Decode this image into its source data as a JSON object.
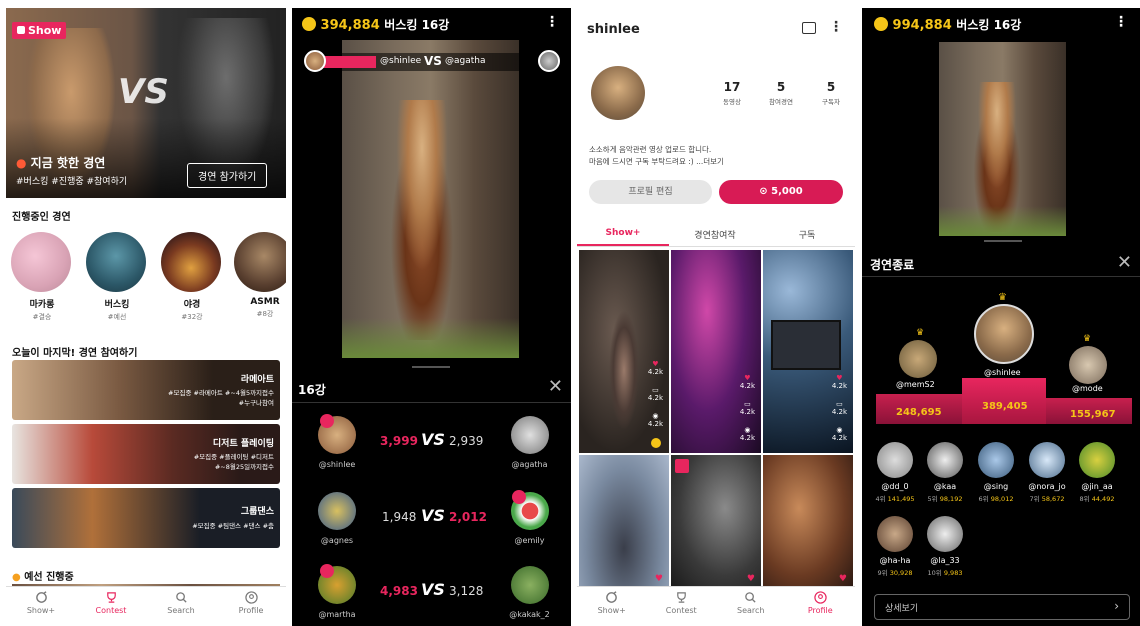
{
  "p1": {
    "hero_logo": "Show",
    "hero_title": "지금 핫한 경연",
    "hero_tags": "#버스킹 #진행중 #참여하기",
    "hero_button": "경연 참가하기",
    "hero_vs": "VS",
    "section1": "진행중인 경연",
    "cats": [
      {
        "name": "마카롱",
        "sub": "#결승"
      },
      {
        "name": "버스킹",
        "sub": "#예선"
      },
      {
        "name": "야경",
        "sub": "#32강"
      },
      {
        "name": "ASMR",
        "sub": "#8강"
      }
    ],
    "section2": "오늘이 마지막! 경연 참여하기",
    "banners": [
      {
        "title": "라메아트",
        "tags1": "#모집중 #라메아트 #~4월5까지접수",
        "tags2": "#누구나참여"
      },
      {
        "title": "디저트 플레이팅",
        "tags1": "#모집중 #플레이팅 #디저트",
        "tags2": "#~8월25일까지접수"
      },
      {
        "title": "그룹댄스",
        "tags1": "#모집중 #팀댄스 #댄스 #춤",
        "tags2": ""
      }
    ],
    "section3": "예선 진행중",
    "nav": [
      "Show+",
      "Contest",
      "Search",
      "Profile"
    ]
  },
  "p2": {
    "coins": "394,884",
    "header": "버스킹 16강",
    "vs_user1": "@shinlee",
    "vs_word": "VS",
    "vs_user2": "@agatha",
    "panel_title": "16강",
    "matches": [
      {
        "l": "@shinlee",
        "ls": "3,999",
        "r": "@agatha",
        "rs": "2,939",
        "win": "l"
      },
      {
        "l": "@agnes",
        "ls": "1,948",
        "r": "@emily",
        "rs": "2,012",
        "win": "r"
      },
      {
        "l": "@martha",
        "ls": "4,983",
        "r": "@kakak_2",
        "rs": "3,128",
        "win": "l"
      }
    ]
  },
  "p3": {
    "username": "shinlee",
    "stats": [
      {
        "n": "17",
        "l": "동영상"
      },
      {
        "n": "5",
        "l": "참여경연"
      },
      {
        "n": "5",
        "l": "구독자"
      }
    ],
    "bio1": "소소하게 음악관련 영상 업로드 합니다.",
    "bio2": "마음에 드시면 구독 부탁드려요 :) ...더보기",
    "edit_btn": "프로필 편집",
    "coin_btn": "5,000",
    "tabs": [
      "Show+",
      "경연참여작",
      "구독"
    ],
    "cnt": "4.2k",
    "nav": [
      "Show+",
      "Contest",
      "Search",
      "Profile"
    ]
  },
  "p4": {
    "coins": "994,884",
    "header": "버스킹 16강",
    "panel_title": "경연종료",
    "podium": [
      {
        "name": "@memS2",
        "score": "248,695"
      },
      {
        "name": "@shinlee",
        "score": "389,405"
      },
      {
        "name": "@mode",
        "score": "155,967"
      }
    ],
    "ranks": [
      {
        "name": "@dd_0",
        "rank": "4위",
        "score": "141,495"
      },
      {
        "name": "@kaa",
        "rank": "5위",
        "score": "98,192"
      },
      {
        "name": "@sing",
        "rank": "6위",
        "score": "98,012"
      },
      {
        "name": "@nora_jo",
        "rank": "7위",
        "score": "58,672"
      },
      {
        "name": "@jin_aa",
        "rank": "8위",
        "score": "44,492"
      },
      {
        "name": "@ha-ha",
        "rank": "9위",
        "score": "30,928"
      },
      {
        "name": "@la_33",
        "rank": "10위",
        "score": "9,983"
      }
    ],
    "more": "상세보기"
  },
  "colors": {
    "accent": "#e8265e",
    "gold": "#f5c518"
  }
}
